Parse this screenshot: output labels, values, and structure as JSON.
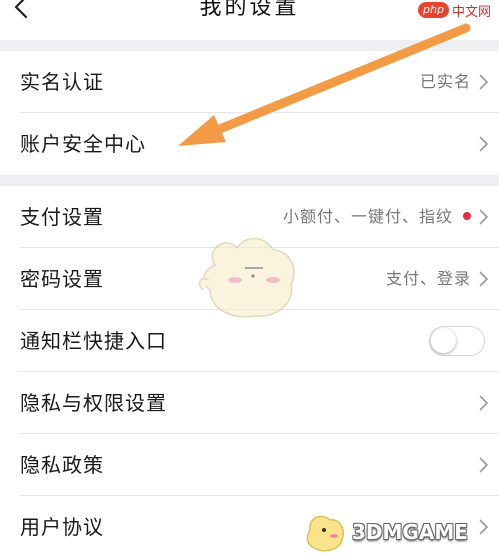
{
  "header": {
    "title": "我的设置"
  },
  "watermarks": {
    "top_badge": "php",
    "top_text": "中文网",
    "bottom_text": "3DMGAME"
  },
  "group1": [
    {
      "label": "实名认证",
      "value": "已实名"
    },
    {
      "label": "账户安全中心",
      "value": ""
    }
  ],
  "group2": [
    {
      "label": "支付设置",
      "value": "小额付、一键付、指纹",
      "has_red_dot": true
    },
    {
      "label": "密码设置",
      "value": "支付、登录"
    },
    {
      "label": "通知栏快捷入口",
      "toggle_on": false
    },
    {
      "label": "隐私与权限设置",
      "value": ""
    },
    {
      "label": "隐私政策",
      "value": ""
    },
    {
      "label": "用户协议",
      "value": ""
    }
  ],
  "colors": {
    "background_gap": "#efeff1",
    "annotation_arrow": "#f39a44",
    "red_dot": "#e8303a"
  },
  "icons": {
    "back": "back-chevron-icon",
    "row_arrow": "chevron-right-icon"
  }
}
